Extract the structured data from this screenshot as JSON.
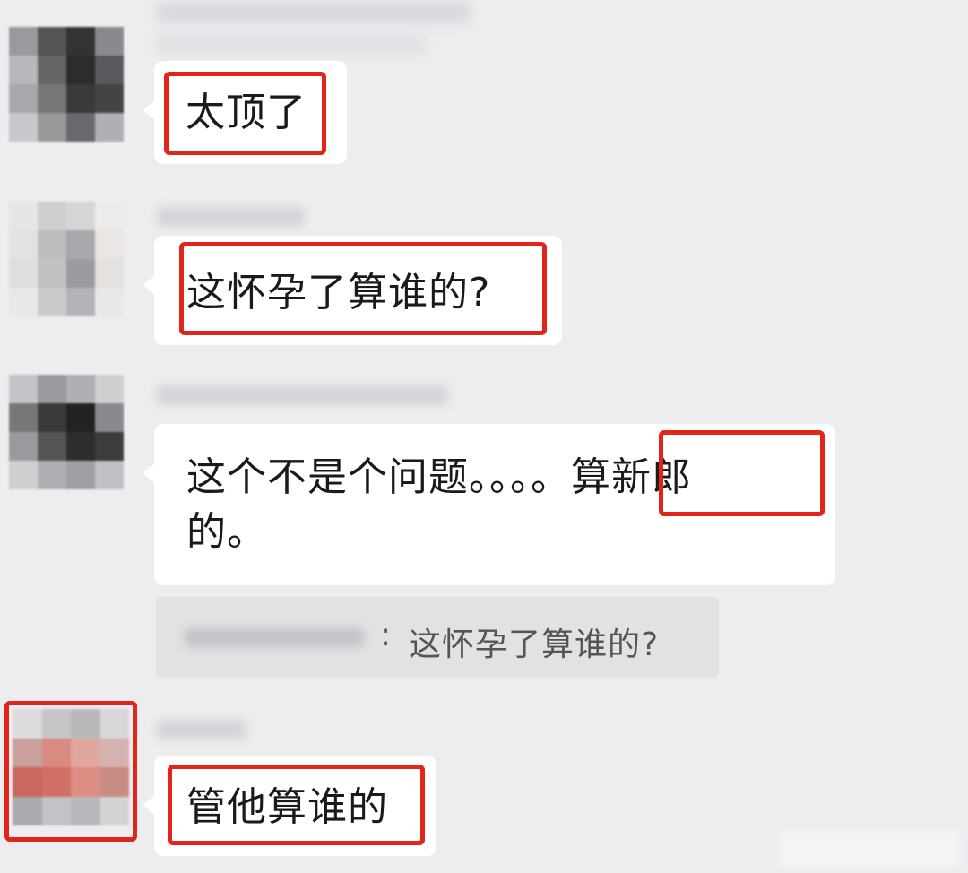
{
  "colors": {
    "background": "#ededf0",
    "bubble": "#ffffff",
    "highlight": "#e1251b",
    "quote_bg": "#e2e2e5"
  },
  "messages": [
    {
      "text": "太顶了"
    },
    {
      "text": "这怀孕了算谁的?"
    },
    {
      "text_part1": "这个不是个问题。。。。",
      "text_highlight": "算新郎",
      "text_line2": "的。"
    },
    {
      "text": "管他算谁的"
    }
  ],
  "quote": {
    "separator": ":",
    "text": "这怀孕了算谁的?"
  }
}
